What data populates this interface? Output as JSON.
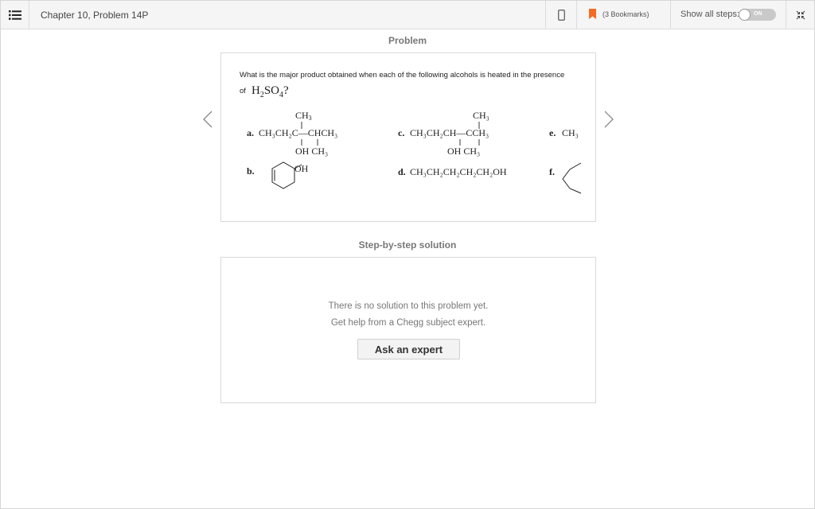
{
  "header": {
    "chapter_title": "Chapter 10, Problem 14P",
    "bookmarks_label": "(3 Bookmarks)",
    "show_steps_label": "Show all steps:",
    "toggle_state": "ON",
    "bookmark_color": "#f36c21"
  },
  "problem": {
    "heading": "Problem",
    "question": "What is the major product obtained when each of the following alcohols is heated in the presence",
    "question_of": "of",
    "reagent": {
      "h": "H",
      "h_sub": "2",
      "so": "SO",
      "so_sub": "4",
      "q": "?"
    },
    "items": {
      "a_label": "a.",
      "a_top": "CH",
      "a_top_sub": "3",
      "a_main": "CH₃CH₂C—CHCH₃",
      "a_bottom": "OH CH₃",
      "b_label": "b.",
      "b_oh": "OH",
      "c_label": "c.",
      "c_top": "CH₃",
      "c_main": "CH₃CH₂CH—CCH₃",
      "c_bottom": "OH   CH₃",
      "d_label": "d.",
      "d_main": "CH₃CH₂CH₂CH₂CH₂OH",
      "e_label": "e.",
      "e_main": "CH₃",
      "f_label": "f."
    }
  },
  "solution": {
    "heading": "Step-by-step solution",
    "no_solution": "There is no solution to this problem yet.",
    "get_help": "Get help from a Chegg subject expert.",
    "ask_button": "Ask an expert"
  }
}
